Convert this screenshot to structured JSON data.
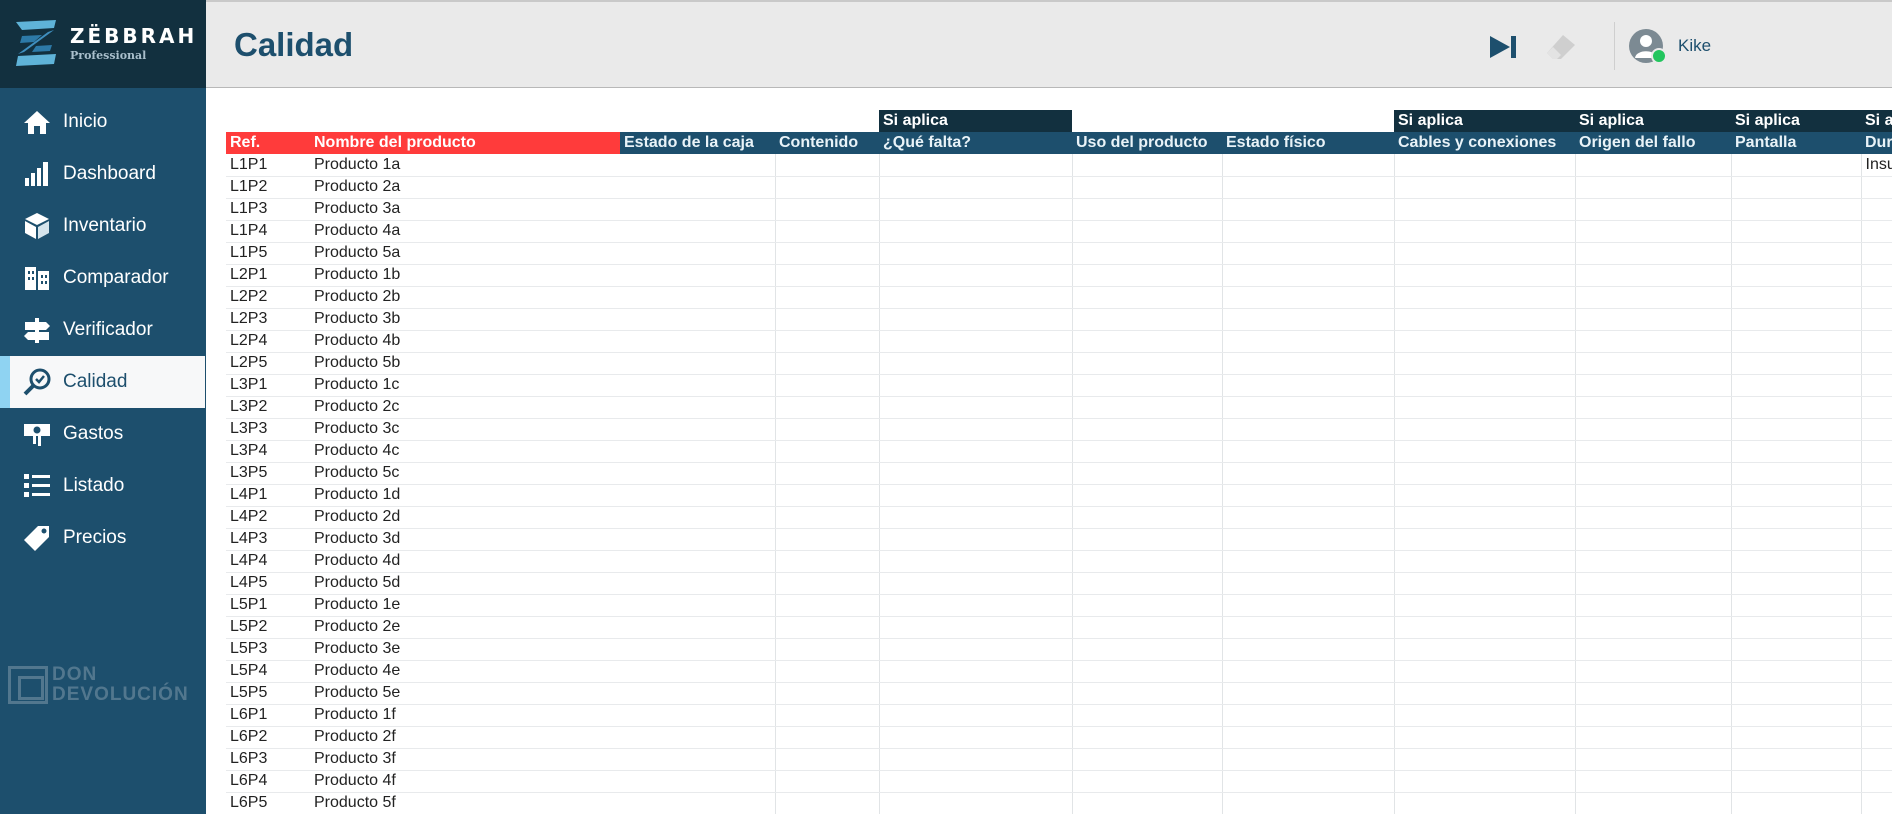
{
  "brand": {
    "name": "ZËBBRAH",
    "sub": "Professional"
  },
  "nav": [
    {
      "label": "Inicio",
      "icon": "home-icon",
      "active": false
    },
    {
      "label": "Dashboard",
      "icon": "bar-chart-icon",
      "active": false
    },
    {
      "label": "Inventario",
      "icon": "box-icon",
      "active": false
    },
    {
      "label": "Comparador",
      "icon": "building-icon",
      "active": false
    },
    {
      "label": "Verificador",
      "icon": "signpost-icon",
      "active": false
    },
    {
      "label": "Calidad",
      "icon": "magnifier-check-icon",
      "active": true
    },
    {
      "label": "Gastos",
      "icon": "money-icon",
      "active": false
    },
    {
      "label": "Listado",
      "icon": "list-icon",
      "active": false
    },
    {
      "label": "Precios",
      "icon": "tag-icon",
      "active": false
    }
  ],
  "sponsor": {
    "line1": "DON",
    "line2": "DEVOLUCIÓN"
  },
  "header": {
    "title": "Calidad",
    "user": "Kike"
  },
  "colors": {
    "sidebar": "#1d4f6d",
    "brand_bg": "#12303f",
    "header_red": "#ff3b3b",
    "active_accent": "#8fd3f2",
    "online": "#22c55e"
  },
  "table": {
    "group_headers": [
      "",
      "",
      "",
      "",
      "Si aplica",
      "",
      "",
      "Si aplica",
      "Si aplica",
      "Si aplica",
      "Si a"
    ],
    "columns": [
      "Ref.",
      "Nombre del producto",
      "Estado de la caja",
      "Contenido",
      "¿Qué falta?",
      "Uso del producto",
      "Estado físico",
      "Cables y conexiones",
      "Origen del fallo",
      "Pantalla",
      "Dur"
    ],
    "rows": [
      [
        "L1P1",
        "Producto 1a",
        "",
        "",
        "",
        "",
        "",
        "",
        "",
        "",
        "Insu"
      ],
      [
        "L1P2",
        "Producto 2a",
        "",
        "",
        "",
        "",
        "",
        "",
        "",
        "",
        ""
      ],
      [
        "L1P3",
        "Producto 3a",
        "",
        "",
        "",
        "",
        "",
        "",
        "",
        "",
        ""
      ],
      [
        "L1P4",
        "Producto 4a",
        "",
        "",
        "",
        "",
        "",
        "",
        "",
        "",
        ""
      ],
      [
        "L1P5",
        "Producto 5a",
        "",
        "",
        "",
        "",
        "",
        "",
        "",
        "",
        ""
      ],
      [
        "L2P1",
        "Producto 1b",
        "",
        "",
        "",
        "",
        "",
        "",
        "",
        "",
        ""
      ],
      [
        "L2P2",
        "Producto 2b",
        "",
        "",
        "",
        "",
        "",
        "",
        "",
        "",
        ""
      ],
      [
        "L2P3",
        "Producto 3b",
        "",
        "",
        "",
        "",
        "",
        "",
        "",
        "",
        ""
      ],
      [
        "L2P4",
        "Producto 4b",
        "",
        "",
        "",
        "",
        "",
        "",
        "",
        "",
        ""
      ],
      [
        "L2P5",
        "Producto 5b",
        "",
        "",
        "",
        "",
        "",
        "",
        "",
        "",
        ""
      ],
      [
        "L3P1",
        "Producto 1c",
        "",
        "",
        "",
        "",
        "",
        "",
        "",
        "",
        ""
      ],
      [
        "L3P2",
        "Producto 2c",
        "",
        "",
        "",
        "",
        "",
        "",
        "",
        "",
        ""
      ],
      [
        "L3P3",
        "Producto 3c",
        "",
        "",
        "",
        "",
        "",
        "",
        "",
        "",
        ""
      ],
      [
        "L3P4",
        "Producto 4c",
        "",
        "",
        "",
        "",
        "",
        "",
        "",
        "",
        ""
      ],
      [
        "L3P5",
        "Producto 5c",
        "",
        "",
        "",
        "",
        "",
        "",
        "",
        "",
        ""
      ],
      [
        "L4P1",
        "Producto 1d",
        "",
        "",
        "",
        "",
        "",
        "",
        "",
        "",
        ""
      ],
      [
        "L4P2",
        "Producto 2d",
        "",
        "",
        "",
        "",
        "",
        "",
        "",
        "",
        ""
      ],
      [
        "L4P3",
        "Producto 3d",
        "",
        "",
        "",
        "",
        "",
        "",
        "",
        "",
        ""
      ],
      [
        "L4P4",
        "Producto 4d",
        "",
        "",
        "",
        "",
        "",
        "",
        "",
        "",
        ""
      ],
      [
        "L4P5",
        "Producto 5d",
        "",
        "",
        "",
        "",
        "",
        "",
        "",
        "",
        ""
      ],
      [
        "L5P1",
        "Producto 1e",
        "",
        "",
        "",
        "",
        "",
        "",
        "",
        "",
        ""
      ],
      [
        "L5P2",
        "Producto 2e",
        "",
        "",
        "",
        "",
        "",
        "",
        "",
        "",
        ""
      ],
      [
        "L5P3",
        "Producto 3e",
        "",
        "",
        "",
        "",
        "",
        "",
        "",
        "",
        ""
      ],
      [
        "L5P4",
        "Producto 4e",
        "",
        "",
        "",
        "",
        "",
        "",
        "",
        "",
        ""
      ],
      [
        "L5P5",
        "Producto 5e",
        "",
        "",
        "",
        "",
        "",
        "",
        "",
        "",
        ""
      ],
      [
        "L6P1",
        "Producto 1f",
        "",
        "",
        "",
        "",
        "",
        "",
        "",
        "",
        ""
      ],
      [
        "L6P2",
        "Producto 2f",
        "",
        "",
        "",
        "",
        "",
        "",
        "",
        "",
        ""
      ],
      [
        "L6P3",
        "Producto 3f",
        "",
        "",
        "",
        "",
        "",
        "",
        "",
        "",
        ""
      ],
      [
        "L6P4",
        "Producto 4f",
        "",
        "",
        "",
        "",
        "",
        "",
        "",
        "",
        ""
      ],
      [
        "L6P5",
        "Producto 5f",
        "",
        "",
        "",
        "",
        "",
        "",
        "",
        "",
        ""
      ]
    ]
  }
}
